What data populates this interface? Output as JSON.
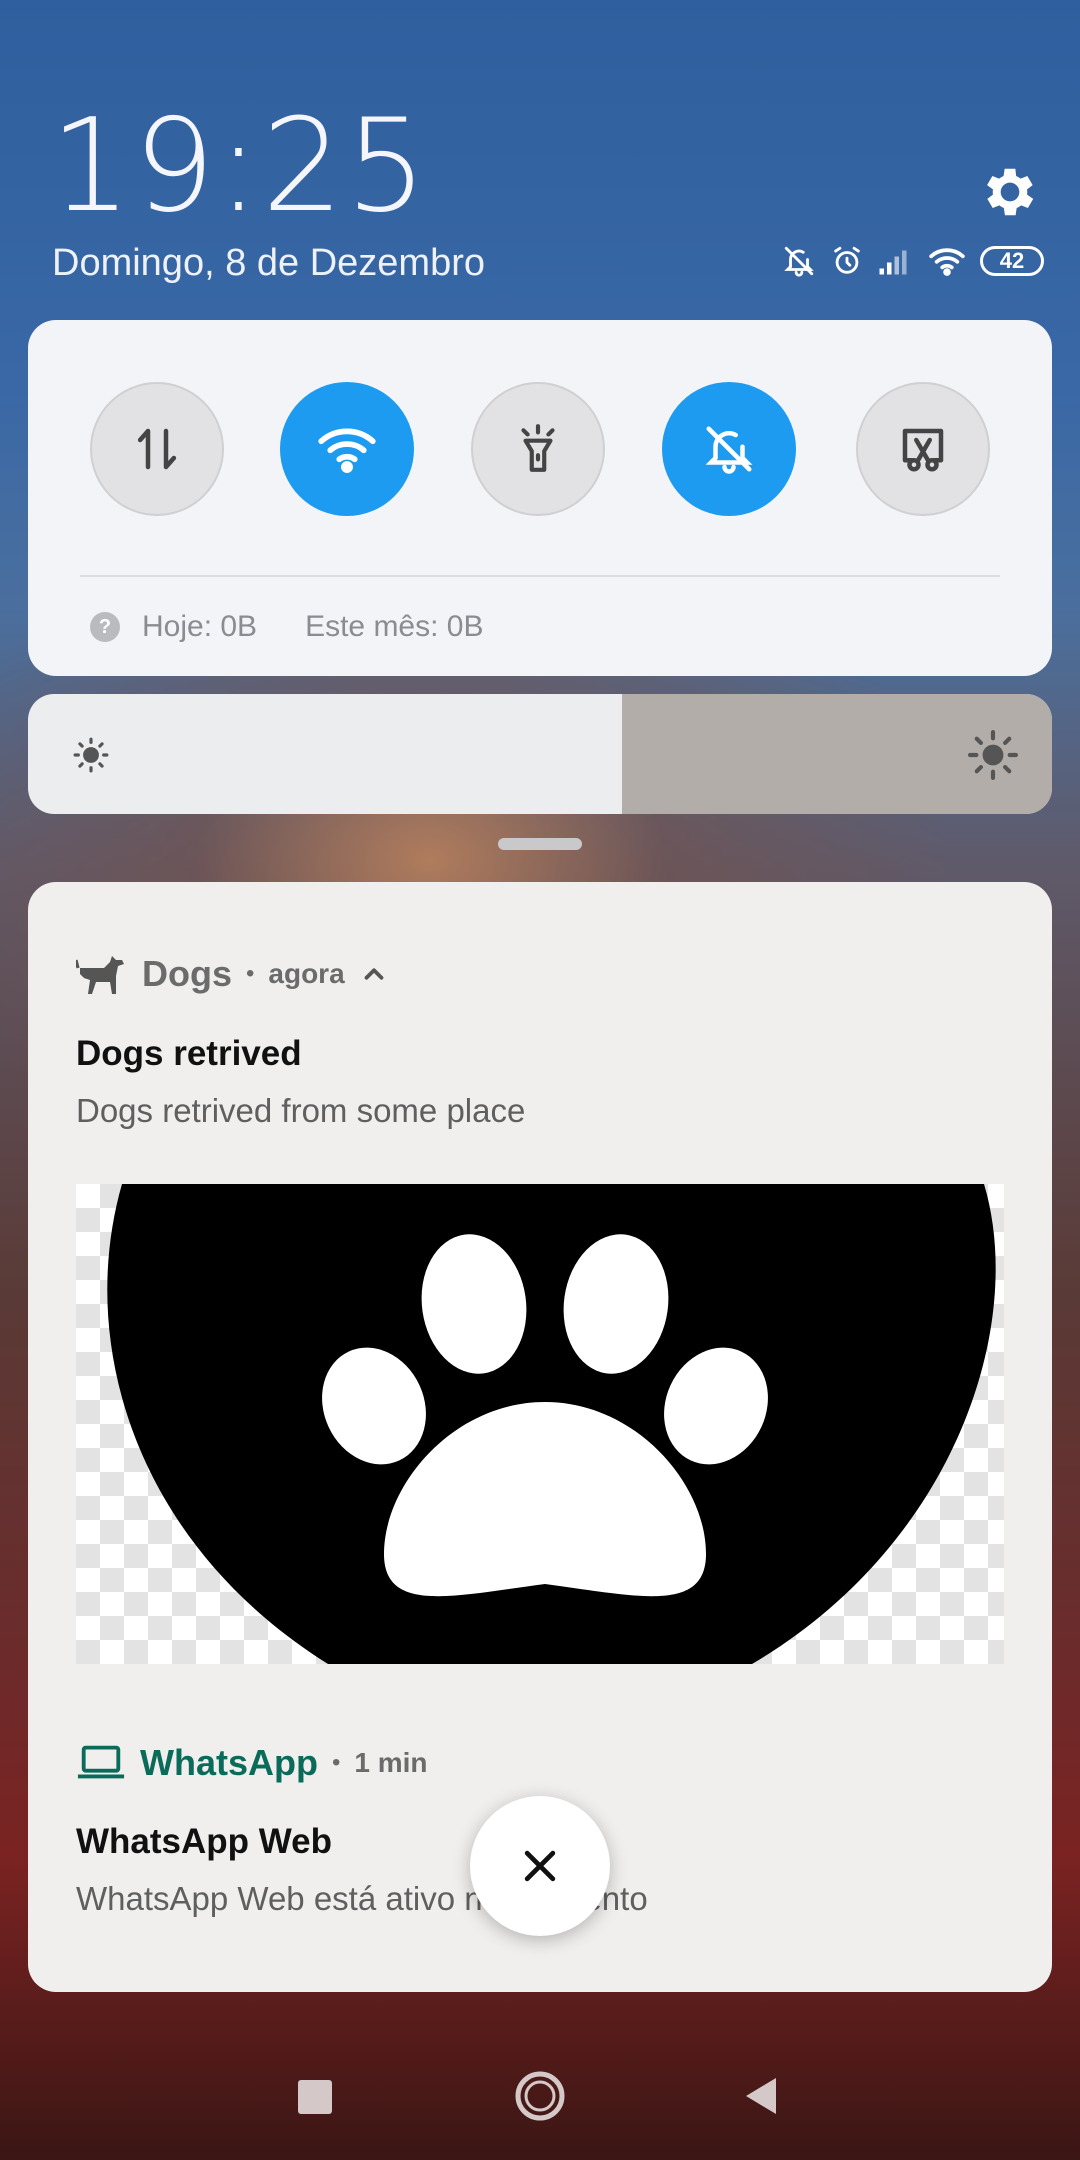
{
  "header": {
    "time": "19:25",
    "date": "Domingo, 8 de Dezembro",
    "battery": "42"
  },
  "quick_settings": {
    "toggles": [
      {
        "name": "mobile-data",
        "icon": "data-transfer-icon",
        "state": "off"
      },
      {
        "name": "wifi",
        "icon": "wifi-icon",
        "state": "on"
      },
      {
        "name": "flashlight",
        "icon": "flashlight-icon",
        "state": "off"
      },
      {
        "name": "mute",
        "icon": "bell-off-icon",
        "state": "on"
      },
      {
        "name": "screenshot",
        "icon": "screenshot-scissors-icon",
        "state": "off"
      }
    ],
    "usage_today": "Hoje: 0B",
    "usage_month": "Este mês: 0B"
  },
  "brightness": {
    "level": 0.58
  },
  "notifications": [
    {
      "app": "Dogs",
      "time": "agora",
      "title": "Dogs retrived",
      "text": "Dogs retrived from some place",
      "image_icon": "paw-icon"
    },
    {
      "app": "WhatsApp",
      "time": "1 min",
      "title": "WhatsApp Web",
      "text": "WhatsApp Web está ativo no momento"
    }
  ],
  "colors": {
    "accent_on": "#1c9bf0",
    "whatsapp": "#0a6b5a",
    "card_bg": "#f3f4f7"
  }
}
